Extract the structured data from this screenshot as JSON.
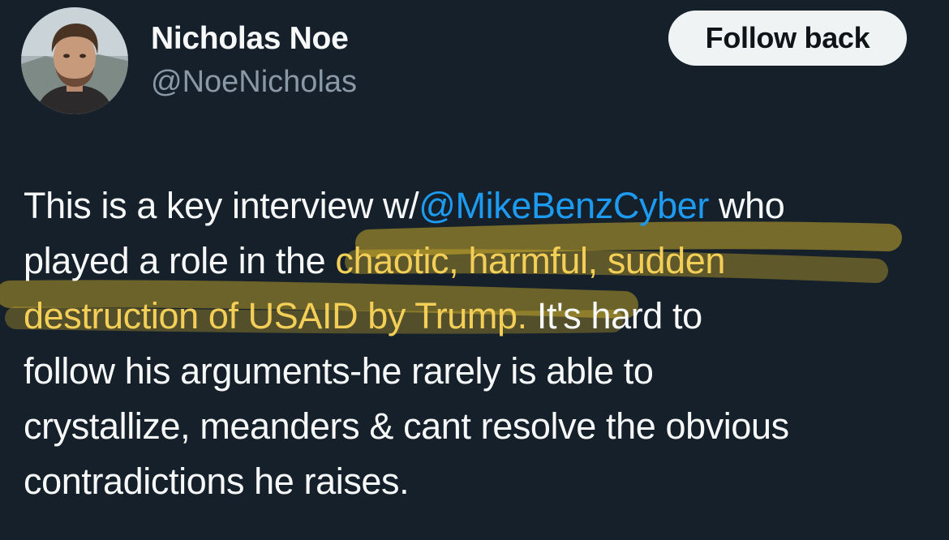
{
  "author": {
    "display_name": "Nicholas Noe",
    "handle": "@NoeNicholas"
  },
  "follow_button_label": "Follow back",
  "tweet": {
    "line1_a": "This is a key interview w/",
    "line1_mention": "@MikeBenzCyber",
    "line1_b": " who",
    "line2_a": "played a role in the ",
    "line2_hl": "chaotic, harmful, sudden",
    "line3_hl": "destruction of USAID by Trump.",
    "line3_b": " It's hard to",
    "line4": "follow his arguments-he rarely is able to",
    "line5": "crystallize, meanders & cant resolve the obvious",
    "line6": "contradictions he raises."
  },
  "colors": {
    "background": "#15202b",
    "mention": "#1d9bf0",
    "highlight_text": "#f4cf58",
    "highlight_marker": "#d7b52a",
    "secondary_text": "#8b98a5",
    "button_bg": "#eff3f4"
  }
}
